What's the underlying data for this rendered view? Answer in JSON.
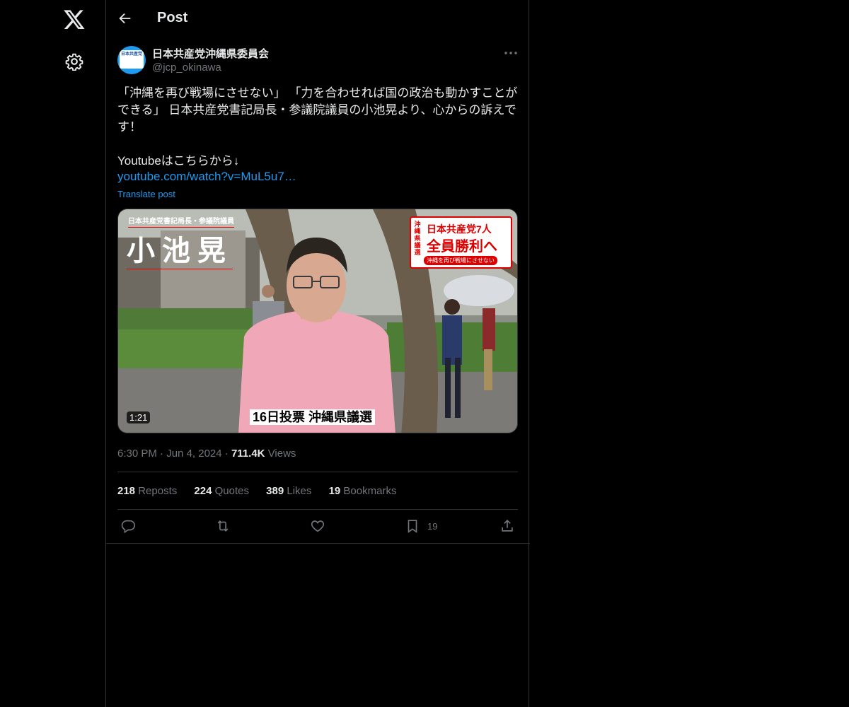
{
  "nav": {
    "logo_icon": "x-logo-icon",
    "settings_icon": "gear-icon"
  },
  "header": {
    "title": "Post",
    "back_icon": "arrow-left-icon"
  },
  "post": {
    "author_name": "日本共産党沖縄県委員会",
    "author_handle": "@jcp_okinawa",
    "avatar_text": "日本共産党",
    "text": "「沖縄を再び戦場にさせない」 「力を合わせれば国の政治も動かすことができる」 日本共産党書記局長・参議院議員の小池晃より、心からの訴えです！\n\nYoutubeはこちらから↓",
    "link": "youtube.com/watch?v=MuL5u7…",
    "translate": "Translate post",
    "media": {
      "top_caption": "日本共産党書記局長・参議院議員",
      "big_name": "小池晃",
      "badge_vertical": "沖縄県議選",
      "badge_line1": "日本共産党7人",
      "badge_line2": "全員勝利へ",
      "badge_line3": "沖縄を再び戦場にさせない",
      "subtitle": "16日投票 沖縄県議選",
      "duration": "1:21"
    },
    "time": "6:30 PM",
    "date": "Jun 4, 2024",
    "views_count": "711.4K",
    "views_label": "Views",
    "stats": {
      "reposts_count": "218",
      "reposts_label": "Reposts",
      "quotes_count": "224",
      "quotes_label": "Quotes",
      "likes_count": "389",
      "likes_label": "Likes",
      "bookmarks_count": "19",
      "bookmarks_label": "Bookmarks"
    },
    "actions": {
      "bookmark_count": "19"
    }
  },
  "colors": {
    "background": "#000000",
    "link": "#1d9bf0",
    "muted": "#71767b",
    "border": "#2f3336"
  }
}
